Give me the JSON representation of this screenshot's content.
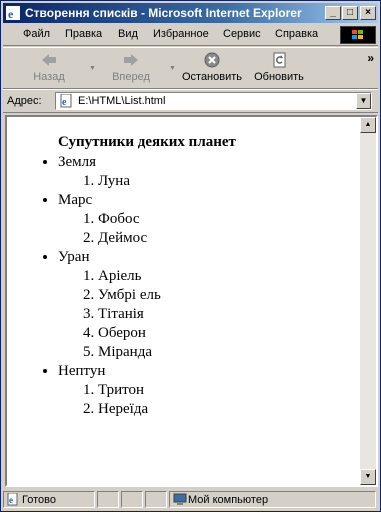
{
  "window": {
    "title": "Створення списків - Microsoft Internet Explorer"
  },
  "menu": [
    "Файл",
    "Правка",
    "Вид",
    "Избранное",
    "Сервис",
    "Справка"
  ],
  "toolbar": {
    "back_label": "Назад",
    "forward_label": "Вперед",
    "stop_label": "Остановить",
    "refresh_label": "Обновить"
  },
  "address": {
    "label": "Адрес:",
    "value": "E:\\HTML\\List.html"
  },
  "document": {
    "heading": "Супутники деяких планет",
    "planets": [
      {
        "name": "Земля",
        "moons": [
          "Луна"
        ]
      },
      {
        "name": "Марс",
        "moons": [
          "Фобос",
          "Деймос"
        ]
      },
      {
        "name": "Уран",
        "moons": [
          "Аріель",
          "Умбрі ель",
          "Тітанія",
          "Оберон",
          "Міранда"
        ]
      },
      {
        "name": "Нептун",
        "moons": [
          "Тритон",
          "Нереїда"
        ]
      }
    ]
  },
  "status": {
    "text": "Готово",
    "zone": "Мой компьютер"
  }
}
